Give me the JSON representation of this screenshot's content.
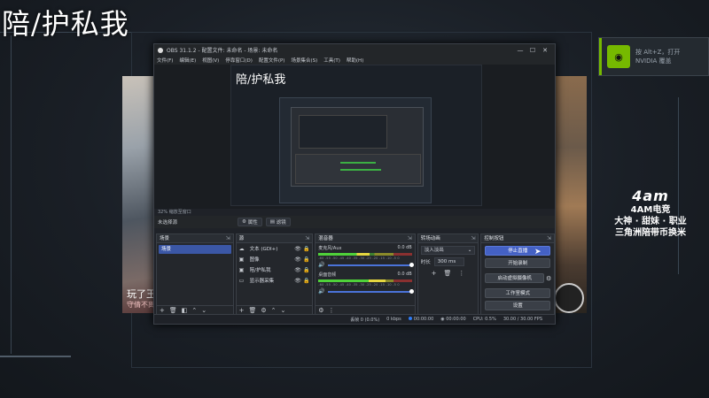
{
  "overlay": {
    "title": "陪/护私我",
    "left_caption": "玩了王",
    "left_caption_sub": "守倩不离",
    "logo_mark": "4am",
    "logo_sub": "4AM电竞",
    "logo_line1": "大神 · 甜妹 · 职业",
    "logo_line2": "三角洲陪带币换米",
    "nvidia_text": "按 Alt+Z，打开 NVIDIA 覆盖"
  },
  "window": {
    "title": "OBS 31.1.2 - 配置文件: 未命名 - 场景: 未命名",
    "minimize": "—",
    "maximize": "☐",
    "close": "✕"
  },
  "menu": [
    "文件(F)",
    "编辑(E)",
    "视图(V)",
    "停靠窗口(D)",
    "配置文件(P)",
    "场景集合(S)",
    "工具(T)",
    "帮助(H)"
  ],
  "preview": {
    "title": "陪/护私我",
    "zoom_status": "32%  缩放至窗口"
  },
  "source_controls": {
    "no_source": "未选择源",
    "properties": "属性",
    "filters": "滤镜"
  },
  "docks": {
    "scenes": {
      "header": "场景",
      "items": [
        "场景"
      ]
    },
    "sources": {
      "header": "源",
      "items": [
        {
          "icon": "☁",
          "name": "文本 (GDI+)"
        },
        {
          "icon": "▣",
          "name": "图像"
        },
        {
          "icon": "▣",
          "name": "陪/护私我"
        },
        {
          "icon": "▭",
          "name": "显示器采集"
        }
      ]
    },
    "mixer": {
      "header": "混音器",
      "channels": [
        {
          "name": "麦克风/Aux",
          "db": "0.0 dB",
          "level": 0.55
        },
        {
          "name": "桌面音频",
          "db": "0.0 dB",
          "level": 0.72
        }
      ],
      "ticks": "-60 -55 -50 -45 -40 -35 -30 -25 -20 -15 -10 -5 0"
    },
    "transitions": {
      "header": "转场动画",
      "type": "淡入淡出",
      "duration_label": "时长",
      "duration": "300 ms"
    },
    "controls": {
      "header": "控制按钮",
      "stop_stream": "停止直播",
      "start_record": "开始录制",
      "virtual_cam": "启动虚拟摄像机",
      "studio_mode": "工作室模式",
      "settings": "设置"
    }
  },
  "status": {
    "dropped": "丢帧 0 (0.0%)",
    "kbps": "0 kbps",
    "stream_time": "00:00:00",
    "rec_time": "00:00:00",
    "cpu": "CPU: 0.5%",
    "fps": "30.00 / 30.00 FPS"
  }
}
